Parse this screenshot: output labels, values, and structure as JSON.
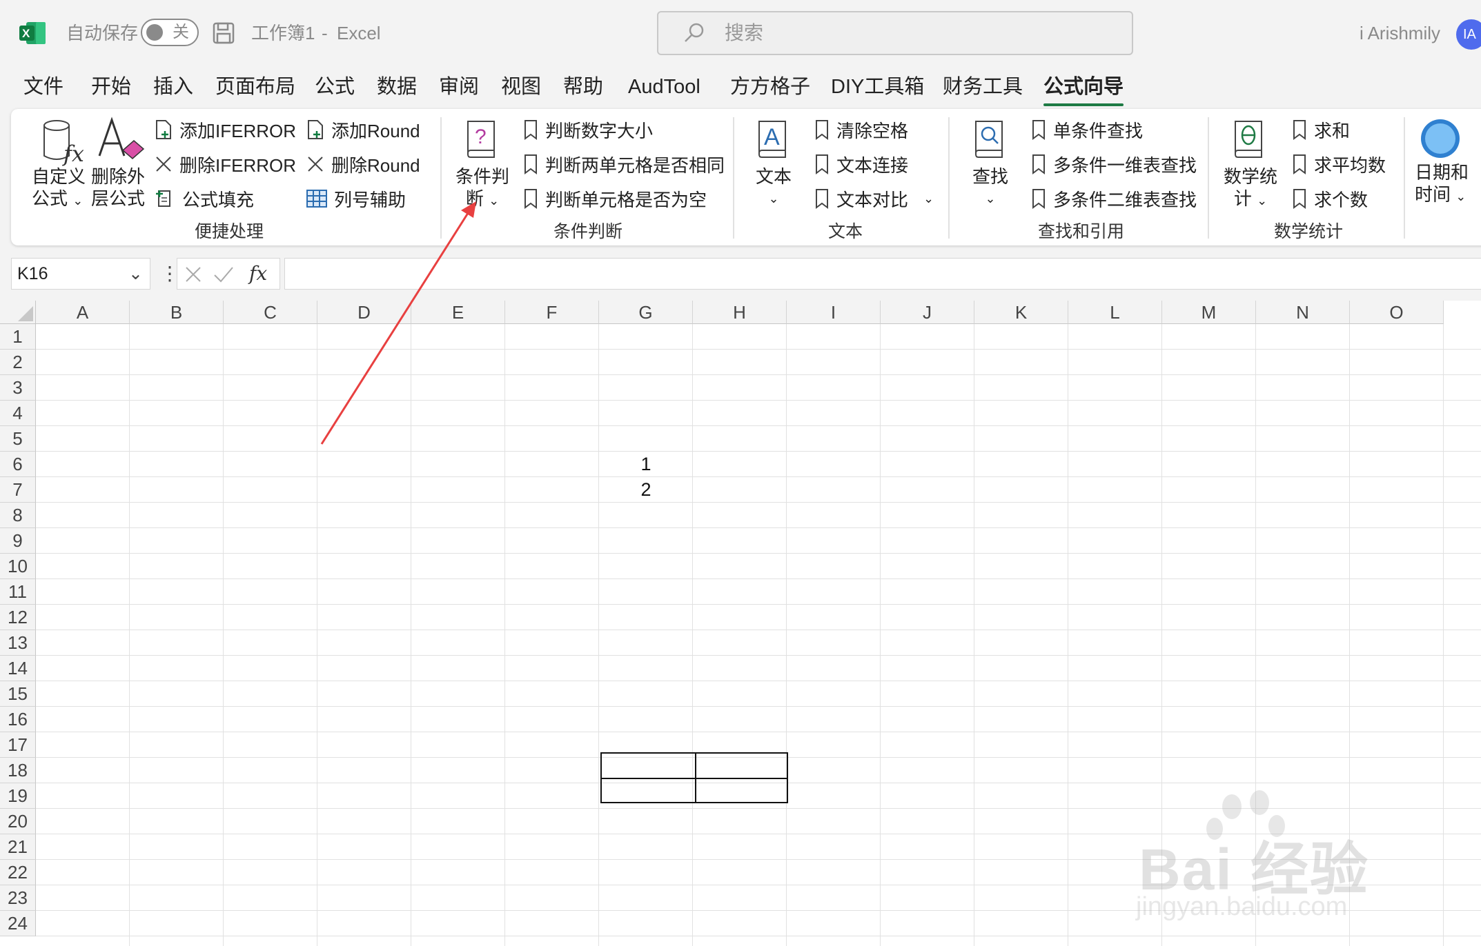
{
  "titlebar": {
    "autosave_label": "自动保存",
    "autosave_state": "关",
    "filename": "工作簿1",
    "separator": "-",
    "app_name": "Excel",
    "search_placeholder": "搜索",
    "user_name": "i Arishmily",
    "user_initials": "IA"
  },
  "tabs": [
    "文件",
    "开始",
    "插入",
    "页面布局",
    "公式",
    "数据",
    "审阅",
    "视图",
    "帮助",
    "AudTool",
    "方方格子",
    "DIY工具箱",
    "财务工具",
    "公式向导"
  ],
  "active_tab": "公式向导",
  "ribbon": {
    "quick": {
      "label": "便捷处理",
      "custom_formula": [
        "自定义",
        "公式"
      ],
      "remove_outer": [
        "删除外",
        "层公式"
      ],
      "add_iferror": "添加IFERROR",
      "del_iferror": "删除IFERROR",
      "formula_fill": "公式填充",
      "add_round": "添加Round",
      "del_round": "删除Round",
      "col_helper": "列号辅助"
    },
    "condition": {
      "label": "条件判断",
      "big_button": [
        "条件判",
        "断"
      ],
      "items": [
        "判断数字大小",
        "判断两单元格是否相同",
        "判断单元格是否为空"
      ]
    },
    "text": {
      "label": "文本",
      "big_button": "文本",
      "items": [
        "清除空格",
        "文本连接",
        "文本对比"
      ]
    },
    "lookup": {
      "label": "查找和引用",
      "big_button": "查找",
      "items": [
        "单条件查找",
        "多条件一维表查找",
        "多条件二维表查找"
      ]
    },
    "math": {
      "label": "数学统计",
      "big_button": [
        "数学统",
        "计"
      ],
      "items": [
        "求和",
        "求平均数",
        "求个数"
      ]
    },
    "datetime": {
      "big_button": [
        "日期和",
        "时间"
      ]
    }
  },
  "formula_bar": {
    "name_box": "K16",
    "fx_label": "fx",
    "formula": ""
  },
  "sheet": {
    "columns": [
      "A",
      "B",
      "C",
      "D",
      "E",
      "F",
      "G",
      "H",
      "I",
      "J",
      "K",
      "L",
      "M",
      "N",
      "O"
    ],
    "rows": [
      "1",
      "2",
      "3",
      "4",
      "5",
      "6",
      "7",
      "8",
      "9",
      "10",
      "11",
      "12",
      "13",
      "14",
      "15",
      "16",
      "17",
      "18",
      "19",
      "20",
      "21",
      "22",
      "23",
      "24"
    ],
    "cells": {
      "G6": "1",
      "G7": "2"
    }
  },
  "watermark": {
    "brand": "Bai 经验",
    "url": "jingyan.baidu.com"
  },
  "colors": {
    "accent": "#1e7a44",
    "arrow": "#e84040",
    "avatar": "#4f6bed"
  }
}
